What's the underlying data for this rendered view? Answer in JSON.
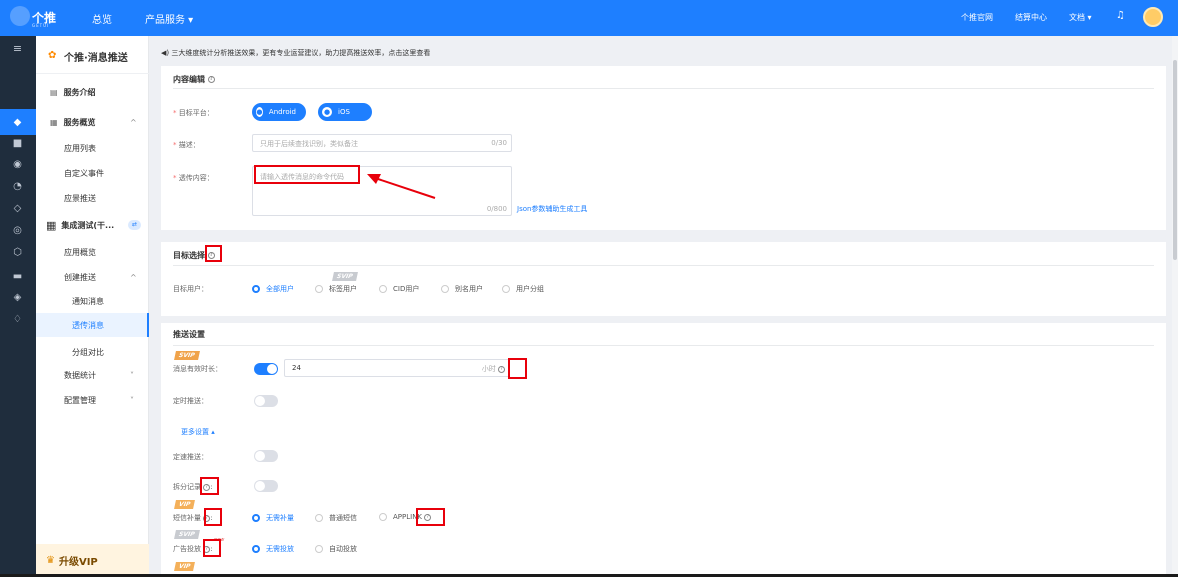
{
  "header": {
    "logo_text": "个推",
    "logo_sub": "GETUI",
    "nav": [
      "总览",
      "产品服务 ▾"
    ],
    "right_links": [
      "个推官网",
      "结算中心",
      "文档 ▾"
    ]
  },
  "sidebar": {
    "title": "个推·消息推送",
    "items": [
      {
        "label": "服务介绍"
      },
      {
        "label": "服务概览",
        "arrow": "^"
      },
      {
        "label": "应用列表"
      },
      {
        "label": "自定义事件"
      },
      {
        "label": "应景推送"
      },
      {
        "label": "集成测试(干...",
        "badge": "⇄"
      },
      {
        "label": "应用概览"
      },
      {
        "label": "创建推送",
        "arrow": "^"
      },
      {
        "label": "通知消息"
      },
      {
        "label": "透传消息"
      },
      {
        "label": "分组对比"
      },
      {
        "label": "数据统计",
        "arrow": "˅"
      },
      {
        "label": "配置管理",
        "arrow": "˅"
      }
    ],
    "upgrade": "升级VIP"
  },
  "notice": "◀) 三大维度统计分析推送效果，更有专业运营建议，助力提高推送效率，点击这里查看",
  "content_edit": {
    "title": "内容编辑",
    "platform_label": "目标平台：",
    "platforms": [
      "Android",
      "iOS"
    ],
    "desc_label": "描述：",
    "desc_placeholder": "只用于后续查找识别，类似备注",
    "desc_count": "0/30",
    "content_label": "透传内容：",
    "content_placeholder": "请输入透传消息的命令代码",
    "content_count": "0/800",
    "json_tool": "Json参数辅助生成工具"
  },
  "target": {
    "title": "目标选择",
    "user_label": "目标用户：",
    "options": [
      "全部用户",
      "标签用户",
      "CID用户",
      "别名用户",
      "用户分组"
    ],
    "selected": "全部用户",
    "svip_badge": "SVIP"
  },
  "push_settings": {
    "title": "推送设置",
    "svip_badge": "SVIP",
    "vip_badge": "VIP",
    "new_badge": "new",
    "ttl_label": "消息有效时长：",
    "ttl_value": "24",
    "ttl_unit": "小时",
    "timed_label": "定时推送：",
    "more": "更多设置 ▴",
    "rate_label": "定速推送：",
    "split_label": "拆分记录",
    "sms_label": "短信补量",
    "sms_options": [
      "无需补量",
      "普通短信",
      "APPLINK"
    ],
    "ad_label": "广告投放",
    "ad_options": [
      "无需投放",
      "自动投放"
    ]
  }
}
